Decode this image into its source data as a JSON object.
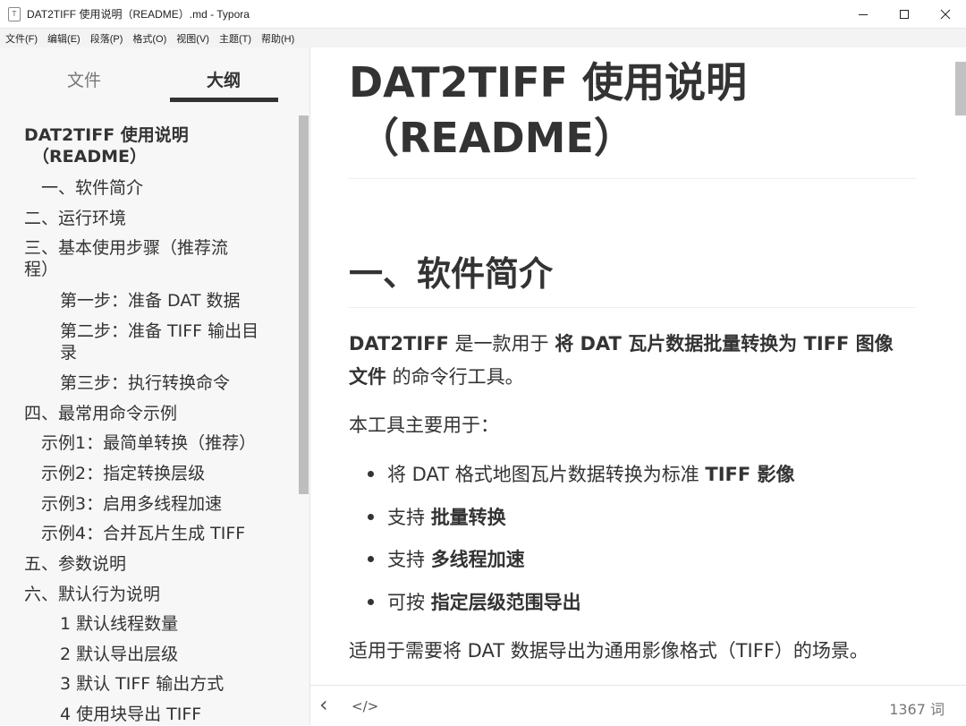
{
  "window": {
    "title": "DAT2TIFF 使用说明（README）.md - Typora",
    "app_icon": "T"
  },
  "menu": [
    "文件(F)",
    "编辑(E)",
    "段落(P)",
    "格式(O)",
    "视图(V)",
    "主题(T)",
    "帮助(H)"
  ],
  "sidebar": {
    "tab_files": "文件",
    "tab_outline": "大纲",
    "outline": [
      "DAT2TIFF 使用说明",
      "（README）",
      "一、软件简介",
      "二、运行环境",
      "三、基本使用步骤（推荐流",
      "程）",
      "第一步：准备 DAT 数据",
      "第二步：准备 TIFF 输出目",
      "录",
      "第三步：执行转换命令",
      "四、最常用命令示例",
      "示例1：最简单转换（推荐）",
      "示例2：指定转换层级",
      "示例3：启用多线程加速",
      "示例4：合并瓦片生成 TIFF",
      "五、参数说明",
      "六、默认行为说明",
      "1 默认线程数量",
      "2 默认导出层级",
      "3 默认 TIFF 输出方式",
      "4 使用块导出 TIFF"
    ]
  },
  "document": {
    "h1_line1": "DAT2TIFF 使用说明",
    "h1_line2": "（README）",
    "h2": "一、软件简介",
    "intro_bold1": "DAT2TIFF",
    "intro_text1": " 是一款用于 ",
    "intro_bold2": "将 DAT 瓦片数据批量转换为 TIFF 图像",
    "intro_bold3": "文件",
    "intro_text2": " 的命令行工具。",
    "usage_intro": "本工具主要用于：",
    "bullets": [
      {
        "text": "将 DAT 格式地图瓦片数据转换为标准 ",
        "bold": "TIFF 影像"
      },
      {
        "text": "支持 ",
        "bold": "批量转换"
      },
      {
        "text": "支持 ",
        "bold": "多线程加速"
      },
      {
        "text": "可按 ",
        "bold": "指定层级范围导出"
      }
    ],
    "closing": "适用于需要将 DAT 数据导出为通用影像格式（TIFF）的场景。"
  },
  "footer": {
    "back_icon": "‹",
    "source_icon": "</>",
    "word_count": "1367 词"
  }
}
